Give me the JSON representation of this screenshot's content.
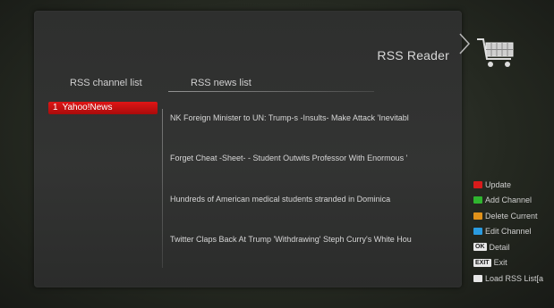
{
  "header": {
    "title": "RSS Reader"
  },
  "channel_list": {
    "heading": "RSS channel list",
    "items": [
      {
        "num": "1",
        "name": "Yahoo!News"
      }
    ]
  },
  "news_list": {
    "heading": "RSS news list",
    "items": [
      "NK Foreign Minister to UN: Trump-s -Insults- Make Attack 'Inevitabl",
      "Forget Cheat -Sheet- - Student Outwits Professor With Enormous '",
      "Hundreds of American medical students stranded in Dominica",
      "Twitter Claps Back At Trump 'Withdrawing' Steph Curry's White Hou"
    ]
  },
  "legend": {
    "update": {
      "label": "Update",
      "color": "#d81b1b"
    },
    "add_channel": {
      "label": "Add Channel",
      "color": "#2fb52f"
    },
    "delete_current": {
      "label": "Delete Current",
      "color": "#e0921a"
    },
    "edit_channel": {
      "label": "Edit Channel",
      "color": "#2a9be0"
    },
    "detail": {
      "key": "OK",
      "label": "Detail"
    },
    "exit": {
      "key": "EXIT",
      "label": "Exit"
    },
    "load": {
      "label": "Load RSS List[a"
    }
  },
  "icons": {
    "cart": "shopping-cart-icon",
    "arrow": "chevron-right-icon"
  }
}
